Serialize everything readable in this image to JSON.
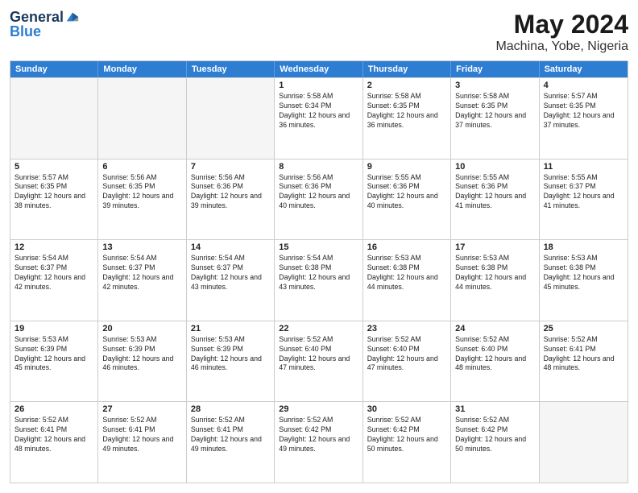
{
  "header": {
    "logo_line1": "General",
    "logo_line2": "Blue",
    "title": "May 2024",
    "subtitle": "Machina, Yobe, Nigeria"
  },
  "days_of_week": [
    "Sunday",
    "Monday",
    "Tuesday",
    "Wednesday",
    "Thursday",
    "Friday",
    "Saturday"
  ],
  "weeks": [
    [
      {
        "day": "",
        "empty": true
      },
      {
        "day": "",
        "empty": true
      },
      {
        "day": "",
        "empty": true
      },
      {
        "day": "1",
        "rise": "5:58 AM",
        "set": "6:34 PM",
        "daylight": "12 hours and 36 minutes."
      },
      {
        "day": "2",
        "rise": "5:58 AM",
        "set": "6:35 PM",
        "daylight": "12 hours and 36 minutes."
      },
      {
        "day": "3",
        "rise": "5:58 AM",
        "set": "6:35 PM",
        "daylight": "12 hours and 37 minutes."
      },
      {
        "day": "4",
        "rise": "5:57 AM",
        "set": "6:35 PM",
        "daylight": "12 hours and 37 minutes."
      }
    ],
    [
      {
        "day": "5",
        "rise": "5:57 AM",
        "set": "6:35 PM",
        "daylight": "12 hours and 38 minutes."
      },
      {
        "day": "6",
        "rise": "5:56 AM",
        "set": "6:35 PM",
        "daylight": "12 hours and 39 minutes."
      },
      {
        "day": "7",
        "rise": "5:56 AM",
        "set": "6:36 PM",
        "daylight": "12 hours and 39 minutes."
      },
      {
        "day": "8",
        "rise": "5:56 AM",
        "set": "6:36 PM",
        "daylight": "12 hours and 40 minutes."
      },
      {
        "day": "9",
        "rise": "5:55 AM",
        "set": "6:36 PM",
        "daylight": "12 hours and 40 minutes."
      },
      {
        "day": "10",
        "rise": "5:55 AM",
        "set": "6:36 PM",
        "daylight": "12 hours and 41 minutes."
      },
      {
        "day": "11",
        "rise": "5:55 AM",
        "set": "6:37 PM",
        "daylight": "12 hours and 41 minutes."
      }
    ],
    [
      {
        "day": "12",
        "rise": "5:54 AM",
        "set": "6:37 PM",
        "daylight": "12 hours and 42 minutes."
      },
      {
        "day": "13",
        "rise": "5:54 AM",
        "set": "6:37 PM",
        "daylight": "12 hours and 42 minutes."
      },
      {
        "day": "14",
        "rise": "5:54 AM",
        "set": "6:37 PM",
        "daylight": "12 hours and 43 minutes."
      },
      {
        "day": "15",
        "rise": "5:54 AM",
        "set": "6:38 PM",
        "daylight": "12 hours and 43 minutes."
      },
      {
        "day": "16",
        "rise": "5:53 AM",
        "set": "6:38 PM",
        "daylight": "12 hours and 44 minutes."
      },
      {
        "day": "17",
        "rise": "5:53 AM",
        "set": "6:38 PM",
        "daylight": "12 hours and 44 minutes."
      },
      {
        "day": "18",
        "rise": "5:53 AM",
        "set": "6:38 PM",
        "daylight": "12 hours and 45 minutes."
      }
    ],
    [
      {
        "day": "19",
        "rise": "5:53 AM",
        "set": "6:39 PM",
        "daylight": "12 hours and 45 minutes."
      },
      {
        "day": "20",
        "rise": "5:53 AM",
        "set": "6:39 PM",
        "daylight": "12 hours and 46 minutes."
      },
      {
        "day": "21",
        "rise": "5:53 AM",
        "set": "6:39 PM",
        "daylight": "12 hours and 46 minutes."
      },
      {
        "day": "22",
        "rise": "5:52 AM",
        "set": "6:40 PM",
        "daylight": "12 hours and 47 minutes."
      },
      {
        "day": "23",
        "rise": "5:52 AM",
        "set": "6:40 PM",
        "daylight": "12 hours and 47 minutes."
      },
      {
        "day": "24",
        "rise": "5:52 AM",
        "set": "6:40 PM",
        "daylight": "12 hours and 48 minutes."
      },
      {
        "day": "25",
        "rise": "5:52 AM",
        "set": "6:41 PM",
        "daylight": "12 hours and 48 minutes."
      }
    ],
    [
      {
        "day": "26",
        "rise": "5:52 AM",
        "set": "6:41 PM",
        "daylight": "12 hours and 48 minutes."
      },
      {
        "day": "27",
        "rise": "5:52 AM",
        "set": "6:41 PM",
        "daylight": "12 hours and 49 minutes."
      },
      {
        "day": "28",
        "rise": "5:52 AM",
        "set": "6:41 PM",
        "daylight": "12 hours and 49 minutes."
      },
      {
        "day": "29",
        "rise": "5:52 AM",
        "set": "6:42 PM",
        "daylight": "12 hours and 49 minutes."
      },
      {
        "day": "30",
        "rise": "5:52 AM",
        "set": "6:42 PM",
        "daylight": "12 hours and 50 minutes."
      },
      {
        "day": "31",
        "rise": "5:52 AM",
        "set": "6:42 PM",
        "daylight": "12 hours and 50 minutes."
      },
      {
        "day": "",
        "empty": true
      }
    ]
  ]
}
